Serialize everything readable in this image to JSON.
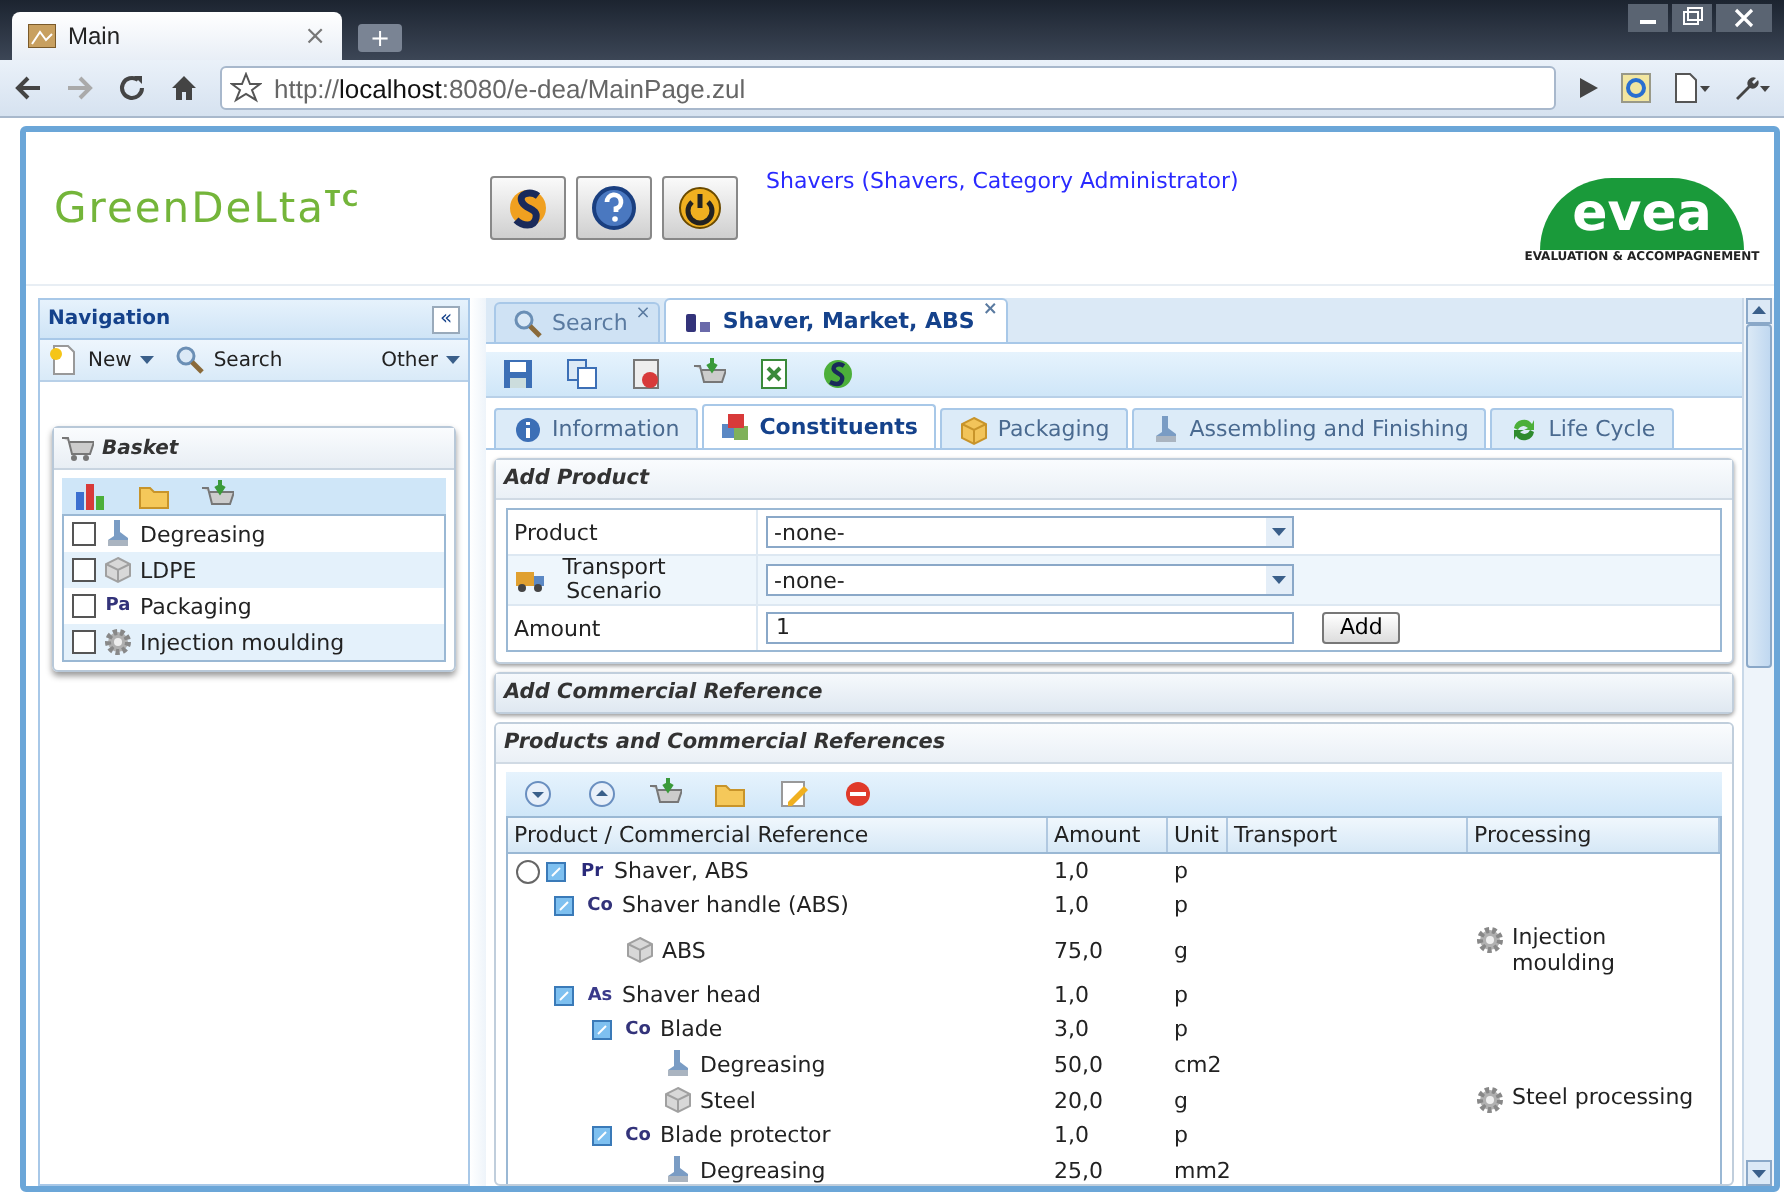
{
  "browser": {
    "tab_title": "Main",
    "tab_close": "×",
    "new_tab": "+",
    "url": "http://**localhost**:8080/e-dea/MainPage.zul"
  },
  "header": {
    "logo": "GreenDeLta$^{TC}$",
    "user_link": "Shavers (Shavers, Category Administrator)",
    "partner_logo": "evea",
    "partner_tagline": "EVALUATION & ACCOMPAGNEMENT"
  },
  "navigation": {
    "title": "Navigation",
    "collapse": "«",
    "toolbar": [
      {
        "kind": "new",
        "label": "New",
        "dropdown": true
      },
      {
        "kind": "search",
        "label": "Search",
        "dropdown": false
      },
      {
        "kind": "other",
        "label": "Other",
        "dropdown": true
      }
    ],
    "basket": {
      "title": "Basket",
      "items": [
        {
          "kind": "process",
          "label": "Degreasing",
          "checked": false
        },
        {
          "kind": "material",
          "label": "LDPE",
          "checked": false
        },
        {
          "kind": "packaging",
          "mark": "Pa",
          "label": "Packaging",
          "checked": false
        },
        {
          "kind": "machining",
          "label": "Injection moulding",
          "checked": false
        }
      ]
    }
  },
  "doc_tabs": [
    {
      "kind": "search",
      "label": "Search",
      "close": "×",
      "selected": false
    },
    {
      "kind": "product",
      "label": "Shaver, Market, ABS",
      "close": "×",
      "selected": true
    }
  ],
  "sub_tabs": [
    {
      "kind": "info",
      "label": "Information",
      "selected": false
    },
    {
      "kind": "constituents",
      "label": "Constituents",
      "selected": true
    },
    {
      "kind": "packaging",
      "label": "Packaging",
      "selected": false
    },
    {
      "kind": "assembling",
      "label": "Assembling and Finishing",
      "selected": false
    },
    {
      "kind": "lifecycle",
      "label": "Life Cycle",
      "selected": false
    }
  ],
  "add_product": {
    "title": "Add Product",
    "expanded": true,
    "fields": [
      {
        "kind": "select",
        "label": "Product",
        "value": "-none-"
      },
      {
        "kind": "transport_select",
        "label": "Transport Scenario",
        "value": "-none-"
      },
      {
        "kind": "text",
        "label": "Amount",
        "value": "1",
        "button": "Add"
      }
    ]
  },
  "commercial_reference": {
    "title": "Add Commercial Reference",
    "expanded": false
  },
  "references": {
    "title": "Products and Commercial References",
    "expanded": true,
    "columns": [
      "Product / Commercial Reference",
      "Amount",
      "Unit",
      "Transport",
      "Processing"
    ],
    "rows": [
      {
        "kind": "product",
        "mark": "Pr",
        "label": "Shaver, ABS",
        "amount": "1,0",
        "unit": "p",
        "selected": false,
        "expanded": true,
        "children": [
          {
            "kind": "component",
            "mark": "Co",
            "label": "Shaver handle (ABS)",
            "amount": "1,0",
            "unit": "p",
            "expanded": true,
            "children": [
              {
                "kind": "material",
                "label": "ABS",
                "amount": "75,0",
                "unit": "g",
                "processing": "Injection moulding"
              }
            ]
          },
          {
            "kind": "assembly",
            "mark": "As",
            "label": "Shaver head",
            "amount": "1,0",
            "unit": "p",
            "expanded": true,
            "children": [
              {
                "kind": "component",
                "mark": "Co",
                "label": "Blade",
                "amount": "3,0",
                "unit": "p",
                "expanded": true,
                "children": [
                  {
                    "kind": "process",
                    "label": "Degreasing",
                    "amount": "50,0",
                    "unit": "cm2"
                  },
                  {
                    "kind": "material",
                    "label": "Steel",
                    "amount": "20,0",
                    "unit": "g",
                    "processing": "Steel processing"
                  }
                ]
              },
              {
                "kind": "component",
                "mark": "Co",
                "label": "Blade protector",
                "amount": "1,0",
                "unit": "p",
                "expanded": true,
                "children": [
                  {
                    "kind": "process",
                    "label": "Degreasing",
                    "amount": "25,0",
                    "unit": "mm2"
                  }
                ]
              }
            ]
          }
        ]
      }
    ]
  }
}
